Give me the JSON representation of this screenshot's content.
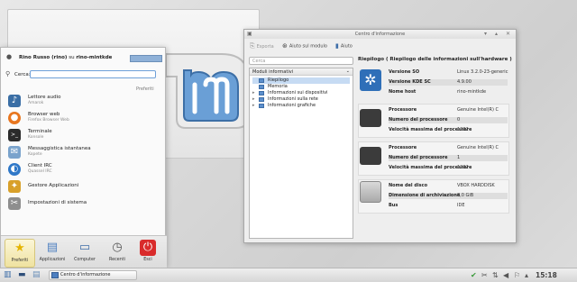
{
  "kickoff": {
    "user_name": "Rino Russo (rino)",
    "user_joiner": "su",
    "host": "rino-mintkde",
    "search_label": "Cerca:",
    "favorites_header": "Preferiti",
    "favorites": [
      {
        "title": "Lettore audio",
        "subtitle": "Amarok",
        "icon": "amarok-icon"
      },
      {
        "title": "Browser web",
        "subtitle": "Firefox Browser Web",
        "icon": "firefox-icon"
      },
      {
        "title": "Terminale",
        "subtitle": "Konsole",
        "icon": "konsole-icon"
      },
      {
        "title": "Messaggistica istantanea",
        "subtitle": "Kopete",
        "icon": "kopete-icon"
      },
      {
        "title": "Client IRC",
        "subtitle": "Quassel IRC",
        "icon": "quassel-icon"
      },
      {
        "title": "Gestore Applicazioni",
        "subtitle": "",
        "icon": "software-manager-icon"
      },
      {
        "title": "Impostazioni di sistema",
        "subtitle": "",
        "icon": "settings-icon"
      }
    ],
    "tabs": [
      {
        "label": "Preferiti",
        "icon": "star-icon",
        "active": true
      },
      {
        "label": "Applicazioni",
        "icon": "applications-icon",
        "active": false
      },
      {
        "label": "Computer",
        "icon": "computer-icon",
        "active": false
      },
      {
        "label": "Recenti",
        "icon": "clock-icon",
        "active": false
      },
      {
        "label": "Esci",
        "icon": "power-icon",
        "active": false
      }
    ]
  },
  "infocenter": {
    "title": "Centro d'informazione",
    "toolbar": {
      "export": "Esporta",
      "module_help": "Aiuto sul modulo",
      "help": "Aiuto"
    },
    "search_placeholder": "Cerca",
    "tree_header": "Moduli informativi",
    "tree": [
      {
        "label": "Riepilogo",
        "selected": true,
        "expandable": false
      },
      {
        "label": "Memoria",
        "selected": false,
        "expandable": false
      },
      {
        "label": "Informazioni sui dispositivi",
        "selected": false,
        "expandable": true
      },
      {
        "label": "Informazioni sulla rete",
        "selected": false,
        "expandable": true
      },
      {
        "label": "Informazioni grafiche",
        "selected": false,
        "expandable": true
      }
    ],
    "panel_title": "Riepilogo ( Riepilogo delle informazioni sull'hardware )",
    "os": [
      {
        "key": "Versione SO",
        "value": "Linux 3.2.0-23-generic"
      },
      {
        "key": "Versione KDE SC",
        "value": "4.9.00"
      },
      {
        "key": "Nome host",
        "value": "rino-mintkde"
      }
    ],
    "cpu0": [
      {
        "key": "Processore",
        "value": "Genuine Intel(R) C"
      },
      {
        "key": "Numero del processore",
        "value": "0"
      },
      {
        "key": "Velocità massima del processore",
        "value": "1292"
      }
    ],
    "cpu1": [
      {
        "key": "Processore",
        "value": "Genuine Intel(R) C"
      },
      {
        "key": "Numero del processore",
        "value": "1"
      },
      {
        "key": "Velocità massima del processore",
        "value": "1292"
      }
    ],
    "disk": [
      {
        "key": "Nome del disco",
        "value": "VBOX HARDDISK"
      },
      {
        "key": "Dimensione di archiviazione",
        "value": "8,0 GiB"
      },
      {
        "key": "Bus",
        "value": "IDE"
      }
    ]
  },
  "taskbar": {
    "task_label": "Centro d'informazione",
    "clock": "15:18"
  },
  "colors": {
    "accent": "#4d7fc0",
    "selection": "#c6dbf3",
    "power": "#d92b2b"
  }
}
